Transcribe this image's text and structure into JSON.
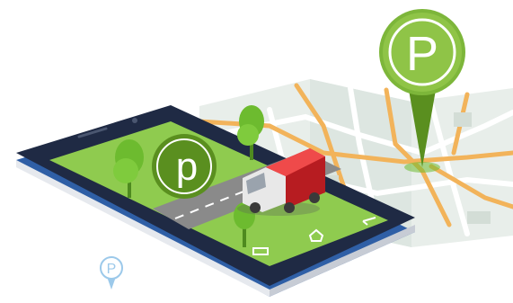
{
  "illustration": {
    "main_pin_letter": "P",
    "screen_badge_letter": "p",
    "small_pin_letter": "P"
  },
  "colors": {
    "pin_green": "#7db63a",
    "pin_green_dark": "#5a8f1f",
    "map_road_orange": "#f2b35a",
    "map_road_white": "#ffffff",
    "map_bg": "#e4ebe7",
    "phone_body": "#1f2a44",
    "phone_edge": "#2f5fa6",
    "screen_grass": "#8fcb4f",
    "screen_road": "#8a8a8a",
    "truck_red": "#d9262b",
    "truck_white": "#e8e8e8",
    "tree_green": "#6dbb2f",
    "small_pin_blue": "#9cc9ea"
  }
}
